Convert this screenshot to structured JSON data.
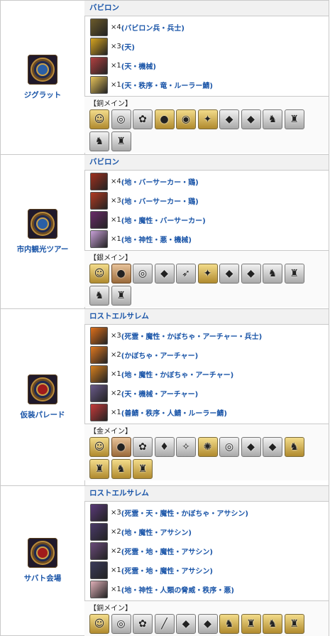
{
  "quests": [
    {
      "name": "ジグラット",
      "emblem": "blue",
      "enemy_header": "バビロン",
      "enemies": [
        {
          "count": "×4",
          "tags": "(バビロン兵・兵士)",
          "color": "#6b5a2a"
        },
        {
          "count": "×3",
          "tags": "(天)",
          "color": "#d8a520"
        },
        {
          "count": "×1",
          "tags": "(天・機械)",
          "color": "#b24040"
        },
        {
          "count": "×1",
          "tags": "(天・秩序・竜・ルーラー鯖)",
          "color": "#e8c45a"
        }
      ],
      "drop_label": "【銅メイン】",
      "drops": [
        {
          "icon": "craft-essence-icon",
          "glyph": "☺",
          "tier": "gold"
        },
        {
          "icon": "chain-icon",
          "glyph": "◎",
          "tier": "silver"
        },
        {
          "icon": "rose-icon",
          "glyph": "✿",
          "tier": "silver"
        },
        {
          "icon": "fruit-icon",
          "glyph": "●",
          "tier": "gold"
        },
        {
          "icon": "orb-icon",
          "glyph": "◉",
          "tier": "gold"
        },
        {
          "icon": "star-piece-icon",
          "glyph": "✦",
          "tier": "gold"
        },
        {
          "icon": "red-gem-icon",
          "glyph": "◆",
          "tier": "silver"
        },
        {
          "icon": "blue-gem-icon",
          "glyph": "◆",
          "tier": "silver"
        },
        {
          "icon": "silver-statue-icon",
          "glyph": "♞",
          "tier": "silver"
        },
        {
          "icon": "silver-statue-icon",
          "glyph": "♜",
          "tier": "silver"
        },
        {
          "icon": "silver-statue-icon",
          "glyph": "♞",
          "tier": "silver"
        },
        {
          "icon": "silver-statue-icon",
          "glyph": "♜",
          "tier": "silver"
        }
      ]
    },
    {
      "name": "市内観光ツアー",
      "emblem": "blue",
      "enemy_header": "バビロン",
      "enemies": [
        {
          "count": "×4",
          "tags": "(地・バーサーカー・鶏)",
          "color": "#a0301e"
        },
        {
          "count": "×3",
          "tags": "(地・バーサーカー・鶏)",
          "color": "#b23a22"
        },
        {
          "count": "×1",
          "tags": "(地・魔性・バーサーカー)",
          "color": "#6a2a6a"
        },
        {
          "count": "×1",
          "tags": "(地・神性・悪・機械)",
          "color": "#c8a0d8"
        }
      ],
      "drop_label": "【銀メイン】",
      "drops": [
        {
          "icon": "craft-essence-icon",
          "glyph": "☺",
          "tier": "gold"
        },
        {
          "icon": "coin-icon",
          "glyph": "●",
          "tier": "bronze"
        },
        {
          "icon": "chain-icon",
          "glyph": "◎",
          "tier": "silver"
        },
        {
          "icon": "purple-gem-icon",
          "glyph": "◆",
          "tier": "silver"
        },
        {
          "icon": "horn-icon",
          "glyph": "➶",
          "tier": "silver"
        },
        {
          "icon": "star-piece-icon",
          "glyph": "✦",
          "tier": "gold"
        },
        {
          "icon": "red-gem-icon",
          "glyph": "◆",
          "tier": "silver"
        },
        {
          "icon": "blue-gem-icon",
          "glyph": "◆",
          "tier": "silver"
        },
        {
          "icon": "silver-statue-icon",
          "glyph": "♞",
          "tier": "silver"
        },
        {
          "icon": "silver-statue-icon",
          "glyph": "♜",
          "tier": "silver"
        },
        {
          "icon": "silver-statue-icon",
          "glyph": "♞",
          "tier": "silver"
        },
        {
          "icon": "silver-statue-icon",
          "glyph": "♜",
          "tier": "silver"
        }
      ]
    },
    {
      "name": "仮装パレード",
      "emblem": "red",
      "enemy_header": "ロストエルサレム",
      "enemies": [
        {
          "count": "×3",
          "tags": "(死霊・魔性・かぼちゃ・アーチャー・兵士)",
          "color": "#e0701a"
        },
        {
          "count": "×2",
          "tags": "(かぼちゃ・アーチャー)",
          "color": "#e07820"
        },
        {
          "count": "×1",
          "tags": "(地・魔性・かぼちゃ・アーチャー)",
          "color": "#d8801e"
        },
        {
          "count": "×2",
          "tags": "(天・機械・アーチャー)",
          "color": "#6a5a8a"
        },
        {
          "count": "×1",
          "tags": "(善鯖・秩序・人鯖・ルーラー鯖)",
          "color": "#c83a3a"
        }
      ],
      "drop_label": "【金メイン】",
      "drops": [
        {
          "icon": "craft-essence-icon",
          "glyph": "☺",
          "tier": "gold"
        },
        {
          "icon": "coin-icon",
          "glyph": "●",
          "tier": "bronze"
        },
        {
          "icon": "rose-icon",
          "glyph": "✿",
          "tier": "silver"
        },
        {
          "icon": "blood-drop-icon",
          "glyph": "♦",
          "tier": "silver"
        },
        {
          "icon": "white-gem-icon",
          "glyph": "✧",
          "tier": "silver"
        },
        {
          "icon": "scale-icon",
          "glyph": "✺",
          "tier": "gold"
        },
        {
          "icon": "chain-icon",
          "glyph": "◎",
          "tier": "silver"
        },
        {
          "icon": "red-gem-icon",
          "glyph": "◆",
          "tier": "silver"
        },
        {
          "icon": "blue-gem-icon",
          "glyph": "◆",
          "tier": "silver"
        },
        {
          "icon": "gold-statue-icon",
          "glyph": "♞",
          "tier": "gold"
        },
        {
          "icon": "gold-statue-icon",
          "glyph": "♜",
          "tier": "gold"
        },
        {
          "icon": "gold-statue-icon",
          "glyph": "♞",
          "tier": "gold"
        },
        {
          "icon": "gold-statue-icon",
          "glyph": "♜",
          "tier": "gold"
        }
      ]
    },
    {
      "name": "サバト会場",
      "emblem": "red",
      "enemy_header": "ロストエルサレム",
      "enemies": [
        {
          "count": "×3",
          "tags": "(死霊・天・魔性・かぼちゃ・アサシン)",
          "color": "#5a3a7a"
        },
        {
          "count": "×2",
          "tags": "(地・魔性・アサシン)",
          "color": "#4a3a6a"
        },
        {
          "count": "×2",
          "tags": "(死霊・地・魔性・アサシン)",
          "color": "#6a4a7a"
        },
        {
          "count": "×1",
          "tags": "(死霊・地・魔性・アサシン)",
          "color": "#3a3a5a"
        },
        {
          "count": "×1",
          "tags": "(地・神性・人類の脅威・秩序・悪)",
          "color": "#e0b0b8"
        }
      ],
      "drop_label": "【銅メイン】",
      "drops": [
        {
          "icon": "craft-essence-icon",
          "glyph": "☺",
          "tier": "gold"
        },
        {
          "icon": "chain-icon",
          "glyph": "◎",
          "tier": "silver"
        },
        {
          "icon": "rose-icon",
          "glyph": "✿",
          "tier": "silver"
        },
        {
          "icon": "stick-icon",
          "glyph": "╱",
          "tier": "silver"
        },
        {
          "icon": "red-gem-icon",
          "glyph": "◆",
          "tier": "silver"
        },
        {
          "icon": "blue-gem-icon",
          "glyph": "◆",
          "tier": "silver"
        },
        {
          "icon": "gold-statue-icon",
          "glyph": "♞",
          "tier": "gold"
        },
        {
          "icon": "gold-statue-icon",
          "glyph": "♜",
          "tier": "gold"
        },
        {
          "icon": "gold-statue-icon",
          "glyph": "♞",
          "tier": "gold"
        },
        {
          "icon": "gold-statue-icon",
          "glyph": "♜",
          "tier": "gold"
        }
      ]
    }
  ]
}
